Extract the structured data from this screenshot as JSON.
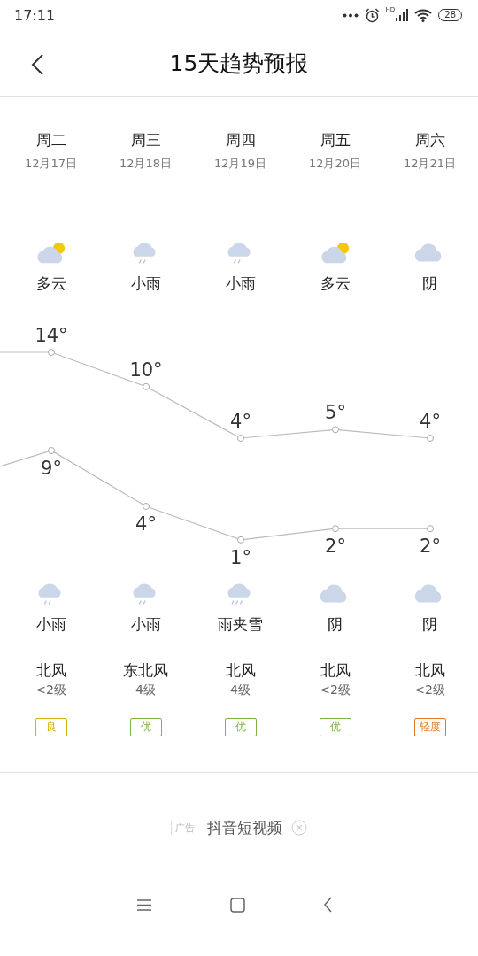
{
  "status_bar": {
    "time": "17:11",
    "signal_label": "HD",
    "battery": "28"
  },
  "header": {
    "title": "15天趋势预报"
  },
  "days": [
    {
      "weekday": "周二",
      "date": "12月17日",
      "day": {
        "kind": "partly_cloudy",
        "condition": "多云"
      },
      "high": "14°",
      "low": "9°",
      "night": {
        "kind": "light_rain",
        "condition": "小雨"
      },
      "wind_direction": "北风",
      "wind_level": "<2级",
      "aqi": {
        "text": "良",
        "color": "#d4b106"
      }
    },
    {
      "weekday": "周三",
      "date": "12月18日",
      "day": {
        "kind": "light_rain",
        "condition": "小雨"
      },
      "high": "10°",
      "low": "4°",
      "night": {
        "kind": "light_rain",
        "condition": "小雨"
      },
      "wind_direction": "东北风",
      "wind_level": "4级",
      "aqi": {
        "text": "优",
        "color": "#7cb342"
      }
    },
    {
      "weekday": "周四",
      "date": "12月19日",
      "day": {
        "kind": "light_rain",
        "condition": "小雨"
      },
      "high": "4°",
      "low": "1°",
      "night": {
        "kind": "sleet",
        "condition": "雨夹雪"
      },
      "wind_direction": "北风",
      "wind_level": "4级",
      "aqi": {
        "text": "优",
        "color": "#7cb342"
      }
    },
    {
      "weekday": "周五",
      "date": "12月20日",
      "day": {
        "kind": "partly_cloudy",
        "condition": "多云"
      },
      "high": "5°",
      "low": "2°",
      "night": {
        "kind": "overcast",
        "condition": "阴"
      },
      "wind_direction": "北风",
      "wind_level": "<2级",
      "aqi": {
        "text": "优",
        "color": "#7cb342"
      }
    },
    {
      "weekday": "周六",
      "date": "12月21日",
      "day": {
        "kind": "overcast",
        "condition": "阴"
      },
      "high": "4°",
      "low": "2°",
      "night": {
        "kind": "overcast",
        "condition": "阴"
      },
      "wind_direction": "北风",
      "wind_level": "<2级",
      "aqi": {
        "text": "轻度",
        "color": "#e07b1f"
      }
    }
  ],
  "ad": {
    "tag": "广告",
    "text": "抖音短视频"
  }
}
